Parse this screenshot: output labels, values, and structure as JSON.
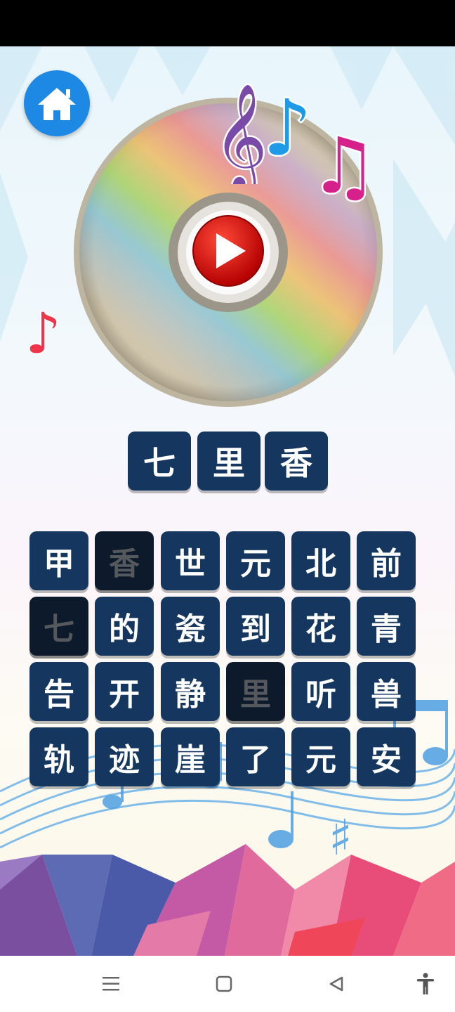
{
  "answer": {
    "chars": [
      "七",
      "里",
      "香"
    ]
  },
  "grid": {
    "rows": [
      [
        {
          "char": "甲",
          "used": false
        },
        {
          "char": "香",
          "used": true
        },
        {
          "char": "世",
          "used": false
        },
        {
          "char": "元",
          "used": false
        },
        {
          "char": "北",
          "used": false
        },
        {
          "char": "前",
          "used": false
        }
      ],
      [
        {
          "char": "七",
          "used": true
        },
        {
          "char": "的",
          "used": false
        },
        {
          "char": "瓷",
          "used": false
        },
        {
          "char": "到",
          "used": false
        },
        {
          "char": "花",
          "used": false
        },
        {
          "char": "青",
          "used": false
        }
      ],
      [
        {
          "char": "告",
          "used": false
        },
        {
          "char": "开",
          "used": false
        },
        {
          "char": "静",
          "used": false
        },
        {
          "char": "里",
          "used": true
        },
        {
          "char": "听",
          "used": false
        },
        {
          "char": "兽",
          "used": false
        }
      ],
      [
        {
          "char": "轨",
          "used": false
        },
        {
          "char": "迹",
          "used": false
        },
        {
          "char": "崖",
          "used": false
        },
        {
          "char": "了",
          "used": false
        },
        {
          "char": "元",
          "used": false
        },
        {
          "char": "安",
          "used": false
        }
      ]
    ]
  },
  "colors": {
    "tile": "#15375f",
    "tile_used": "#0d1a2b",
    "home_button": "#1e88e5",
    "play_button": "#d40000"
  },
  "icons": {
    "home": "home-icon",
    "play": "play-icon",
    "nav_menu": "menu-icon",
    "nav_home": "square-icon",
    "nav_back": "back-triangle-icon",
    "accessibility": "accessibility-icon"
  }
}
